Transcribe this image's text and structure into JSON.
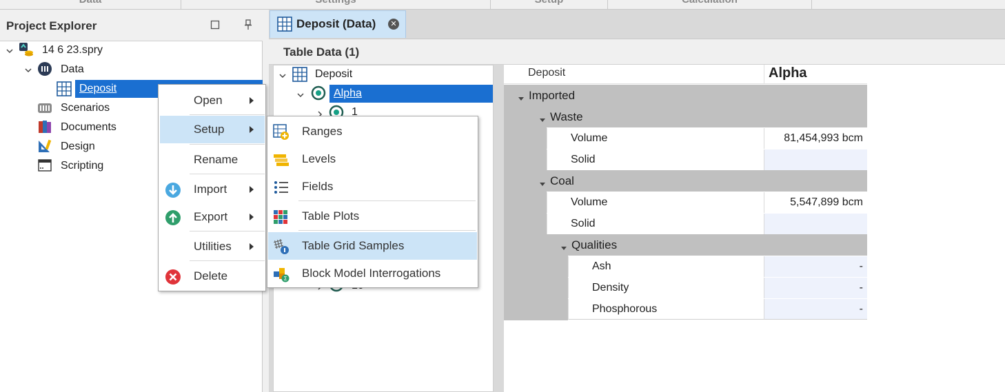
{
  "ribbon": {
    "groups": [
      "Data",
      "Settings",
      "Setup",
      "Calculation"
    ]
  },
  "project_explorer": {
    "title": "Project Explorer",
    "items": [
      {
        "label": "14 6 23.spry",
        "icon": "project-icon"
      },
      {
        "label": "Data",
        "icon": "data-icon"
      },
      {
        "label": "Deposit",
        "icon": "table-icon"
      },
      {
        "label": "Scenarios",
        "icon": "scenarios-icon"
      },
      {
        "label": "Documents",
        "icon": "documents-icon"
      },
      {
        "label": "Design",
        "icon": "design-icon"
      },
      {
        "label": "Scripting",
        "icon": "scripting-icon"
      }
    ]
  },
  "document_tab": {
    "label": "Deposit (Data)"
  },
  "table_data": {
    "title": "Table Data (1)",
    "tree": [
      {
        "label": "Deposit"
      },
      {
        "label": "Alpha"
      },
      {
        "label": "1"
      },
      {
        "label": "10"
      }
    ]
  },
  "property_grid": {
    "header_label": "Deposit",
    "header_value": "Alpha",
    "cat_imported": "Imported",
    "cat_waste": "Waste",
    "waste_volume_label": "Volume",
    "waste_volume_value": "81,454,993 bcm",
    "waste_solid_label": "Solid",
    "cat_coal": "Coal",
    "coal_volume_label": "Volume",
    "coal_volume_value": "5,547,899 bcm",
    "coal_solid_label": "Solid",
    "cat_qualities": "Qualities",
    "ash_label": "Ash",
    "ash_value": "-",
    "density_label": "Density",
    "density_value": "-",
    "phosphorous_label": "Phosphorous",
    "phosphorous_value": "-"
  },
  "context_menu": {
    "items": [
      "Open",
      "Setup",
      "Rename",
      "Import",
      "Export",
      "Utilities",
      "Delete"
    ]
  },
  "setup_submenu": {
    "items": [
      "Ranges",
      "Levels",
      "Fields",
      "Table Plots",
      "Table Grid Samples",
      "Block Model Interrogations"
    ]
  },
  "colors": {
    "selection": "#1a6fd1",
    "menu_highlight": "#cce4f7",
    "category_grey": "#c0c0c0",
    "value_cell": "#eef2fc"
  }
}
